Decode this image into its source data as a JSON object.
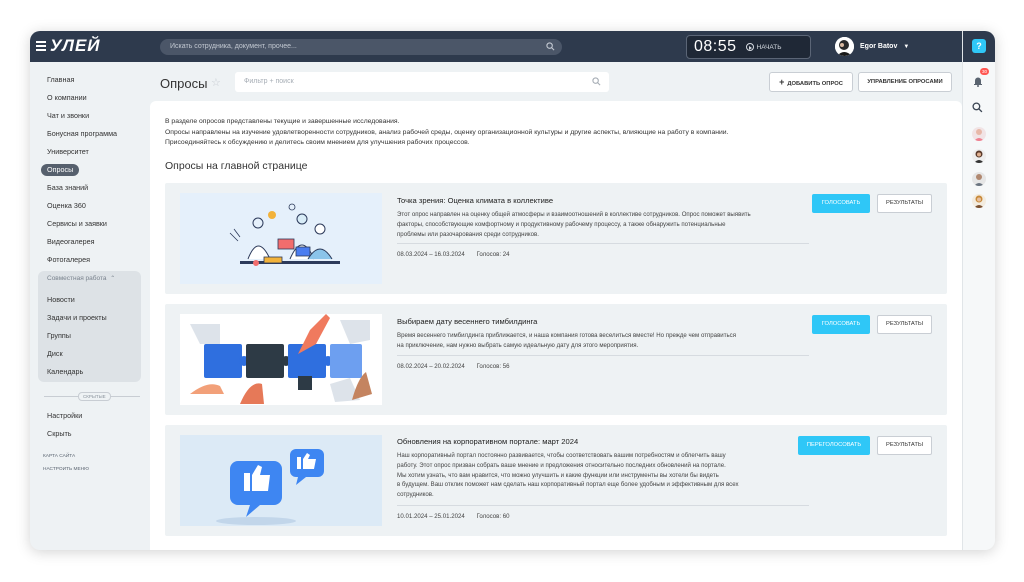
{
  "app": {
    "logo": "УЛЕЙ"
  },
  "topbar": {
    "search_placeholder": "Искать сотрудника, документ, прочее...",
    "clock": "08:55",
    "start_label": "НАЧАТЬ",
    "user_name": "Egor Batov"
  },
  "rail": {
    "notifications_count": "30",
    "help": "?"
  },
  "sidebar": {
    "items": [
      {
        "label": "Главная"
      },
      {
        "label": "О компании"
      },
      {
        "label": "Чат и звонки"
      },
      {
        "label": "Бонусная программа"
      },
      {
        "label": "Университет"
      },
      {
        "label": "Опросы"
      },
      {
        "label": "База знаний"
      },
      {
        "label": "Оценка 360"
      },
      {
        "label": "Сервисы и заявки"
      },
      {
        "label": "Видеогалерея"
      },
      {
        "label": "Фотогалерея"
      }
    ],
    "group": {
      "title": "Совместная работа",
      "items": [
        {
          "label": "Новости"
        },
        {
          "label": "Задачи и проекты"
        },
        {
          "label": "Группы"
        },
        {
          "label": "Диск"
        },
        {
          "label": "Календарь"
        }
      ]
    },
    "hidden_label": "СКРЫТЫЕ",
    "bottom_items": [
      {
        "label": "Настройки"
      },
      {
        "label": "Скрыть"
      }
    ],
    "sitemap_link": "КАРТА САЙТА",
    "menu_settings_link": "НАСТРОИТЬ МЕНЮ"
  },
  "main": {
    "title": "Опросы",
    "filter_placeholder": "Фильтр + поиск",
    "add_button": "ДОБАВИТЬ ОПРОС",
    "manage_button": "УПРАВЛЕНИЕ ОПРОСАМИ",
    "intro": [
      "В разделе опросов представлены текущие и завершенные исследования.",
      "Опросы направлены на изучение удовлетворенности сотрудников, анализ рабочей среды, оценку организационной культуры и другие аспекты, влияющие на работу в компании.",
      "Присоединяйтесь к обсуждению и делитесь своим мнением для улучшения рабочих процессов."
    ],
    "section_title": "Опросы на главной странице",
    "polls": [
      {
        "title": "Точка зрения: Оценка климата в коллективе",
        "desc_lines": [
          "Этот опрос направлен на оценку общей атмосферы и взаимоотношений в коллективе сотрудников. Опрос поможет выявить",
          "факторы, способствующие комфортному и продуктивному рабочему процессу, а также обнаружить потенциальные",
          "проблемы или разочарования среди сотрудников."
        ],
        "dates": "08.03.2024 – 16.03.2024",
        "votes": "Голосов: 24",
        "vote_button": "ГОЛОСОВАТЬ",
        "results_button": "РЕЗУЛЬТАТЫ"
      },
      {
        "title": "Выбираем дату весеннего тимбилдинга",
        "desc_lines": [
          "Время весеннего тимбилдинга приближается, и наша компания готова веселиться вместе! Но прежде чем отправиться",
          "на приключение, нам нужно выбрать самую идеальную дату для этого мероприятия."
        ],
        "dates": "08.02.2024 – 20.02.2024",
        "votes": "Голосов: 56",
        "vote_button": "ГОЛОСОВАТЬ",
        "results_button": "РЕЗУЛЬТАТЫ"
      },
      {
        "title": "Обновления на корпоративном портале: март 2024",
        "desc_lines": [
          "Наш корпоративный портал постоянно развивается, чтобы соответствовать вашим потребностям и облегчить вашу",
          "работу. Этот опрос призван собрать ваше мнение и предложения относительно последних обновлений на портале.",
          "Мы хотим узнать, что вам нравится, что можно улучшить и какие функции или инструменты вы хотели бы видеть",
          "в будущем. Ваш отклик поможет нам сделать наш корпоративный портал еще более удобным и эффективным для всех",
          "сотрудников."
        ],
        "dates": "10.01.2024 – 25.01.2024",
        "votes": "Голосов: 60",
        "vote_button": "ПЕРЕГОЛОСОВАТЬ",
        "results_button": "РЕЗУЛЬТАТЫ"
      }
    ]
  },
  "colors": {
    "topbar": "#2e3a4d",
    "accent": "#2fc7f7",
    "card_bg": "#eef2f4",
    "active_nav": "#56606d",
    "badge": "#ff5752"
  }
}
